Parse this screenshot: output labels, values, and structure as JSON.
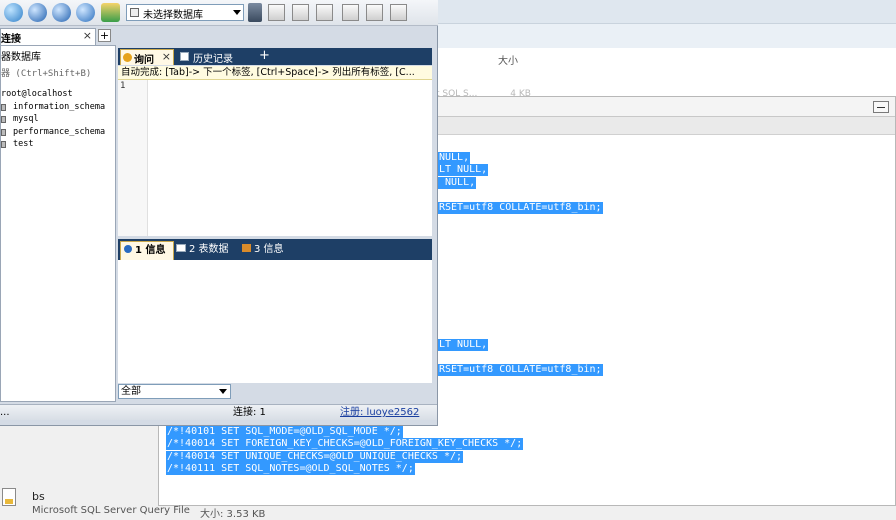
{
  "background": {
    "explorer_size_header": "大小",
    "faded_row": [
      "t SQL S...",
      "4 KB"
    ],
    "editor_selected_lines": [
      "NULL,",
      "LT NULL,",
      " NULL,",
      "RSET=utf8 COLLATE=utf8_bin;",
      "LT NULL,",
      "RSET=utf8 COLLATE=utf8_bin;",
      "/*!40101 SET SQL_MODE=@OLD_SQL_MODE */;",
      "/*!40014 SET FOREIGN_KEY_CHECKS=@OLD_FOREIGN_KEY_CHECKS */;",
      "/*!40014 SET UNIQUE_CHECKS=@OLD_UNIQUE_CHECKS */;",
      "/*!40111 SET SQL_NOTES=@OLD_SQL_NOTES */;"
    ],
    "file": {
      "name": "bs",
      "type": "Microsoft SQL Server Query File",
      "size": "大小: 3.53 KB"
    }
  },
  "toolbar": {
    "database_select": "未选择数据库"
  },
  "left_panel": {
    "tab_label": "连接",
    "heading": "器数据库",
    "shortcut_hint": "器 (Ctrl+Shift+B)",
    "tree": [
      {
        "label": "root@localhost",
        "root": true
      },
      {
        "label": "information_schema"
      },
      {
        "label": "mysql"
      },
      {
        "label": "performance_schema"
      },
      {
        "label": "test"
      }
    ]
  },
  "query": {
    "tab_query": "询问",
    "tab_history": "历史记录",
    "autocomplete_hint": "自动完成: [Tab]-> 下一个标签, [Ctrl+Space]-> 列出所有标签, [C...",
    "line_number": "1"
  },
  "results": {
    "tab_info": "1 信息",
    "tab_table": "2 表数据",
    "tab_msg": "3 信息",
    "filter": "全部"
  },
  "statusbar": {
    "left": "...",
    "connection": "连接: 1",
    "registration": "注册: luoye2562"
  },
  "colors": {
    "selection": "#3399ff",
    "tabbar": "#1e3f66",
    "active_tab": "#fff8e5"
  }
}
